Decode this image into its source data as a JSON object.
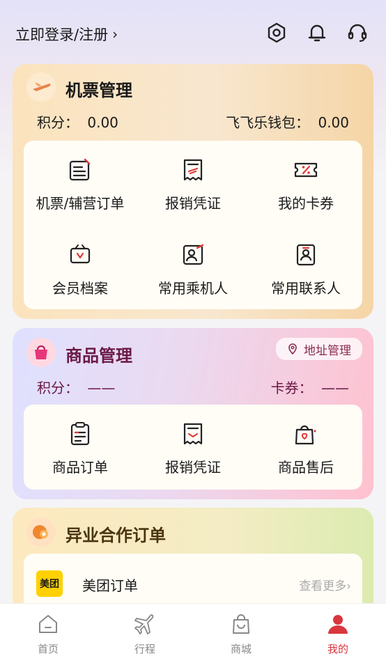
{
  "header": {
    "login_label": "立即登录/注册",
    "chevron": "›",
    "icons": [
      "settings-icon",
      "bell-icon",
      "headset-icon"
    ]
  },
  "flight": {
    "title": "机票管理",
    "points_label": "积分：",
    "points_value": "0.00",
    "wallet_label": "飞飞乐钱包：",
    "wallet_value": "0.00",
    "items": [
      {
        "label": "机票/辅营订单",
        "icon": "order-list-icon"
      },
      {
        "label": "报销凭证",
        "icon": "receipt-icon"
      },
      {
        "label": "我的卡券",
        "icon": "coupon-icon"
      },
      {
        "label": "会员档案",
        "icon": "member-file-icon"
      },
      {
        "label": "常用乘机人",
        "icon": "passenger-icon"
      },
      {
        "label": "常用联系人",
        "icon": "contact-icon"
      }
    ]
  },
  "goods": {
    "title": "商品管理",
    "address_label": "地址管理",
    "points_label": "积分：",
    "points_value": "——",
    "coupon_label": "卡券：",
    "coupon_value": "——",
    "items": [
      {
        "label": "商品订单",
        "icon": "clipboard-icon"
      },
      {
        "label": "报销凭证",
        "icon": "receipt-icon"
      },
      {
        "label": "商品售后",
        "icon": "after-sale-bag-icon"
      }
    ]
  },
  "partner": {
    "title": "异业合作订单",
    "meituan_logo": "美团",
    "meituan_label": "美团订单",
    "more_label": "查看更多›"
  },
  "tabs": [
    {
      "label": "首页",
      "icon": "home-icon"
    },
    {
      "label": "行程",
      "icon": "plane-icon"
    },
    {
      "label": "商城",
      "icon": "shopping-bag-icon"
    },
    {
      "label": "我的",
      "icon": "user-icon"
    }
  ],
  "colors": {
    "accent": "#d9363e",
    "goods_title": "#6b1845",
    "flight_title": "#1a1a1a",
    "partner_title": "#4a3410"
  }
}
